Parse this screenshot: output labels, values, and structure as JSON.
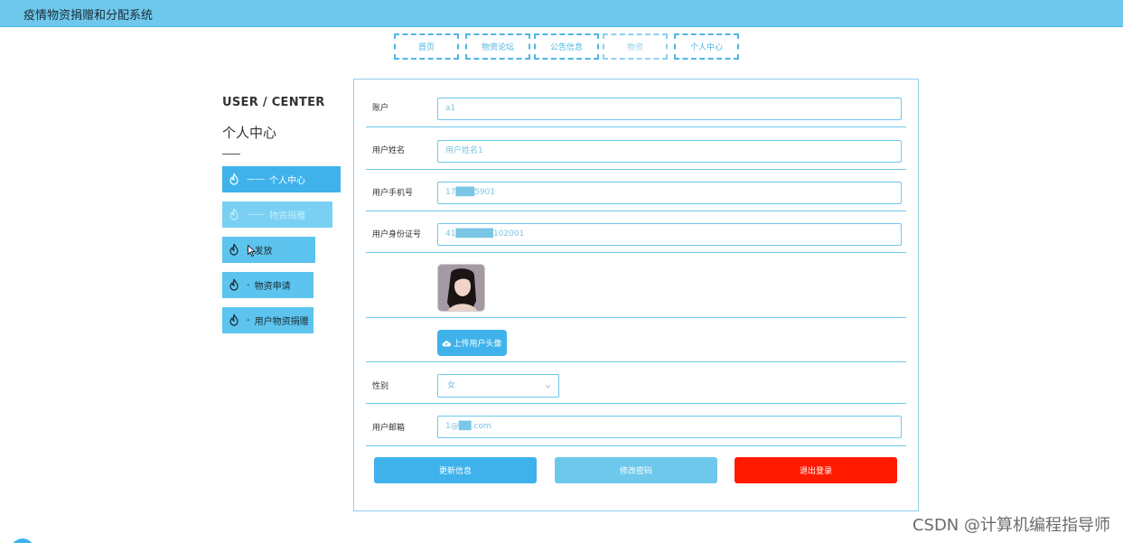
{
  "app": {
    "title": "疫情物资捐赠和分配系统"
  },
  "nav": [
    "首页",
    "物资论坛",
    "公告信息",
    "物资",
    "个人中心"
  ],
  "sidebar": {
    "title_en": "USER / CENTER",
    "title_cn": "个人中心",
    "items": [
      {
        "prefix": "——",
        "label": "个人中心"
      },
      {
        "prefix": "——",
        "label": "物资捐赠"
      },
      {
        "prefix": "-",
        "label": "发放"
      },
      {
        "prefix": "-",
        "label": "物资申请"
      },
      {
        "prefix": "-",
        "label": "用户物资捐赠"
      }
    ]
  },
  "form": {
    "account": {
      "label": "账户",
      "value": "a1"
    },
    "name": {
      "label": "用户姓名",
      "value": "用户姓名1"
    },
    "phone": {
      "label": "用户手机号",
      "value": "17███5901"
    },
    "idcard": {
      "label": "用户身份证号",
      "value": "41██████102001"
    },
    "upload_label": "上传用户头像",
    "gender": {
      "label": "性别",
      "value": "女"
    },
    "email": {
      "label": "用户邮箱",
      "value": "1@██.com"
    }
  },
  "buttons": {
    "update": "更新信息",
    "password": "修改密码",
    "logout": "退出登录"
  },
  "watermark": "CSDN @计算机编程指导师",
  "colors": {
    "header": "#6ec8ec",
    "accent": "#3fb2ec",
    "danger": "#ff1a00"
  },
  "icons": {
    "sidebar": "fire-icon",
    "upload": "cloud-upload-icon",
    "select": "chevron-down-icon"
  }
}
